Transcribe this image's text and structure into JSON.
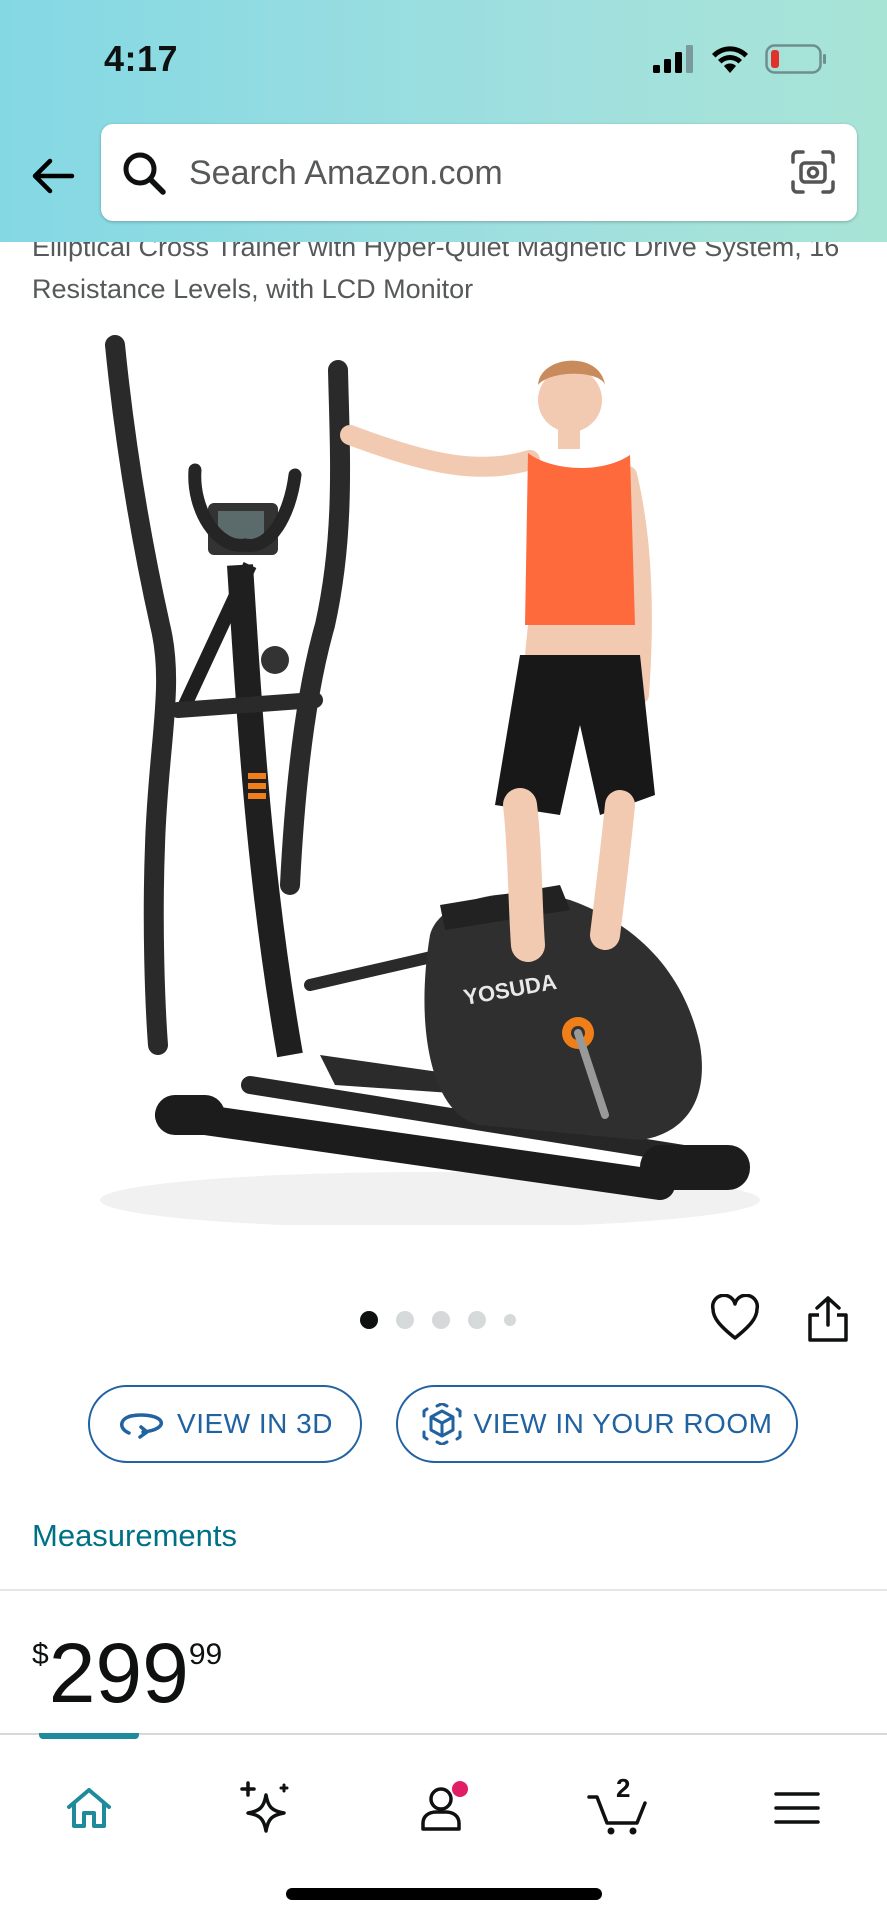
{
  "status_bar": {
    "time": "4:17",
    "icons": [
      "signal-icon",
      "wifi-icon",
      "battery-icon"
    ],
    "battery_color": "#e0312b"
  },
  "header": {
    "back_icon": "arrow-left-icon",
    "search_placeholder": "Search Amazon.com",
    "search_icon": "search-icon",
    "camera_icon": "camera-scan-icon"
  },
  "product": {
    "title": "Elliptical Cross Trainer with Hyper-Quiet Magnetic Drive System, 16 Resistance Levels, with LCD Monitor",
    "brand_on_image": "YOSUDA",
    "carousel": {
      "count": 5,
      "active_index": 0
    },
    "wishlist_icon": "heart-icon",
    "share_icon": "share-icon",
    "view_3d_label": "VIEW IN 3D",
    "view_room_label": "VIEW IN YOUR ROOM",
    "measurements_label": "Measurements",
    "price": {
      "symbol": "$",
      "whole": "299",
      "fraction": "99"
    }
  },
  "bottom_nav": {
    "items": [
      {
        "name": "home",
        "icon": "home-icon",
        "active": true
      },
      {
        "name": "sparkle",
        "icon": "sparkle-icon",
        "active": false
      },
      {
        "name": "account",
        "icon": "account-icon",
        "active": false,
        "badge": true
      },
      {
        "name": "cart",
        "icon": "cart-icon",
        "active": false,
        "count": "2"
      },
      {
        "name": "menu",
        "icon": "menu-icon",
        "active": false
      }
    ],
    "active_color": "#1f8a9c",
    "badge_color": "#e11d66"
  },
  "colors": {
    "link": "#007185",
    "button_outline": "#2162a1"
  }
}
